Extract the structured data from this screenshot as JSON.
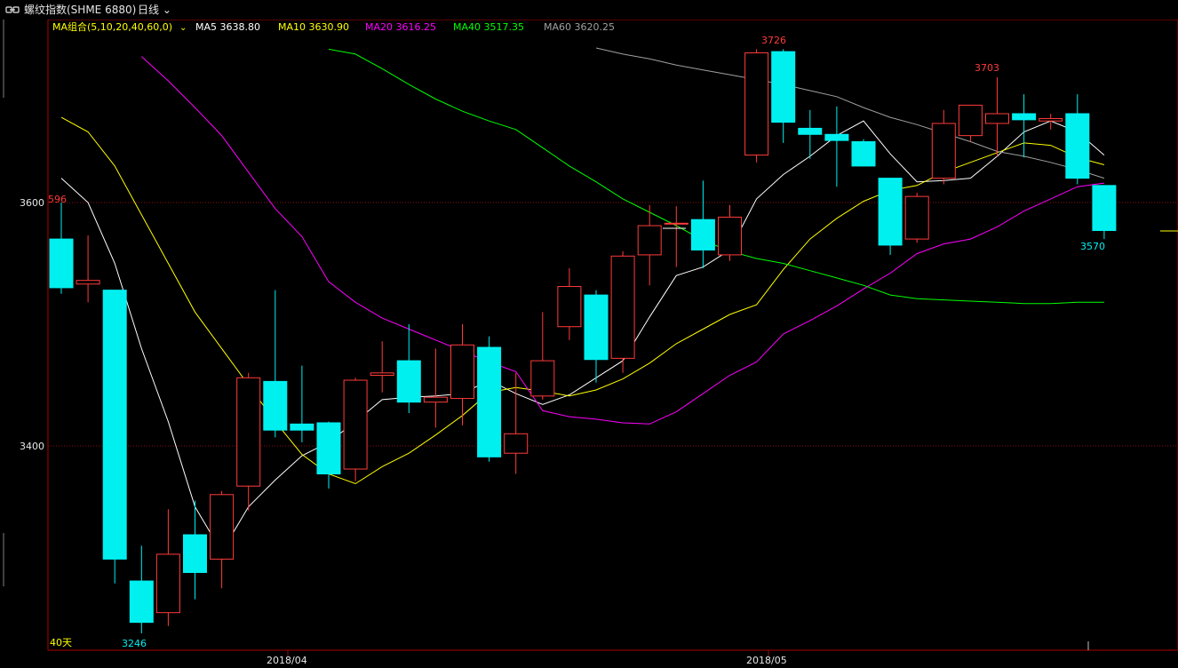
{
  "window": {
    "title": "螺纹指数(SHME 6880)",
    "period": "日线"
  },
  "ma_legend": {
    "group_label": "MA组合(5,10,20,40,60,0)",
    "items": [
      {
        "label": "MA5 3638.80",
        "color": "#ffffff"
      },
      {
        "label": "MA10 3630.90",
        "color": "#ffff00"
      },
      {
        "label": "MA20 3616.25",
        "color": "#ff00ff"
      },
      {
        "label": "MA40 3517.35",
        "color": "#00ff00"
      },
      {
        "label": "MA60 3620.25",
        "color": "#a0a0a0"
      }
    ]
  },
  "labels": {
    "left_price": "596",
    "range": "40天",
    "high_1": "3726",
    "high_2": "3703",
    "low": "3246",
    "last_low": "3570"
  },
  "colors": {
    "up": "#ff3b3b",
    "down": "#00f0f0",
    "grid": "#8a1010",
    "axis": "#b00000"
  },
  "chart_data": {
    "type": "candlestick",
    "y_ticks": [
      3600,
      3400
    ],
    "x_labels": [
      "2018/04",
      "2018/05"
    ],
    "candles": [
      {
        "open": 3570,
        "close": 3530,
        "high": 3600,
        "low": 3525
      },
      {
        "open": 3533,
        "close": 3536,
        "high": 3573,
        "low": 3518
      },
      {
        "open": 3528,
        "close": 3307,
        "high": 3528,
        "low": 3287
      },
      {
        "open": 3289,
        "close": 3255,
        "high": 3318,
        "low": 3246
      },
      {
        "open": 3263,
        "close": 3311,
        "high": 3348,
        "low": 3252
      },
      {
        "open": 3327,
        "close": 3296,
        "high": 3355,
        "low": 3274
      },
      {
        "open": 3307,
        "close": 3360,
        "high": 3363,
        "low": 3283
      },
      {
        "open": 3367,
        "close": 3456,
        "high": 3460,
        "low": 3347
      },
      {
        "open": 3453,
        "close": 3413,
        "high": 3528,
        "low": 3407
      },
      {
        "open": 3418,
        "close": 3413,
        "high": 3466,
        "low": 3403
      },
      {
        "open": 3419,
        "close": 3377,
        "high": 3420,
        "low": 3365
      },
      {
        "open": 3381,
        "close": 3454,
        "high": 3456,
        "low": 3371
      },
      {
        "open": 3458,
        "close": 3460,
        "high": 3486,
        "low": 3444
      },
      {
        "open": 3470,
        "close": 3436,
        "high": 3500,
        "low": 3427
      },
      {
        "open": 3436,
        "close": 3440,
        "high": 3480,
        "low": 3415
      },
      {
        "open": 3439,
        "close": 3483,
        "high": 3500,
        "low": 3417
      },
      {
        "open": 3481,
        "close": 3391,
        "high": 3490,
        "low": 3387
      },
      {
        "open": 3394,
        "close": 3410,
        "high": 3460,
        "low": 3377
      },
      {
        "open": 3441,
        "close": 3470,
        "high": 3510,
        "low": 3438
      },
      {
        "open": 3498,
        "close": 3531,
        "high": 3546,
        "low": 3487
      },
      {
        "open": 3524,
        "close": 3471,
        "high": 3528,
        "low": 3452
      },
      {
        "open": 3472,
        "close": 3556,
        "high": 3560,
        "low": 3460
      },
      {
        "open": 3557,
        "close": 3581,
        "high": 3598,
        "low": 3532
      },
      {
        "open": 3583,
        "close": 3583,
        "high": 3597,
        "low": 3547
      },
      {
        "open": 3586,
        "close": 3561,
        "high": 3618,
        "low": 3546
      },
      {
        "open": 3557,
        "close": 3588,
        "high": 3598,
        "low": 3552
      },
      {
        "open": 3639,
        "close": 3723,
        "high": 3726,
        "low": 3633
      },
      {
        "open": 3724,
        "close": 3666,
        "high": 3726,
        "low": 3649
      },
      {
        "open": 3661,
        "close": 3656,
        "high": 3676,
        "low": 3636
      },
      {
        "open": 3656,
        "close": 3651,
        "high": 3679,
        "low": 3613
      },
      {
        "open": 3650,
        "close": 3630,
        "high": 3652,
        "low": 3630
      },
      {
        "open": 3620,
        "close": 3565,
        "high": 3620,
        "low": 3557
      },
      {
        "open": 3570,
        "close": 3605,
        "high": 3608,
        "low": 3567
      },
      {
        "open": 3620,
        "close": 3665,
        "high": 3676,
        "low": 3615
      },
      {
        "open": 3655,
        "close": 3680,
        "high": 3680,
        "low": 3650
      },
      {
        "open": 3665,
        "close": 3673,
        "high": 3703,
        "low": 3638
      },
      {
        "open": 3673,
        "close": 3668,
        "high": 3689,
        "low": 3637
      },
      {
        "open": 3667,
        "close": 3669,
        "high": 3673,
        "low": 3660
      },
      {
        "open": 3673,
        "close": 3620,
        "high": 3689,
        "low": 3615
      },
      {
        "open": 3614,
        "close": 3577,
        "high": 3614,
        "low": 3570
      }
    ],
    "ma": {
      "ma5": [
        3620,
        3600,
        3550,
        3480,
        3420,
        3350,
        3313,
        3350,
        3372,
        3392,
        3403,
        3420,
        3438,
        3440,
        3441,
        3443,
        3454,
        3443,
        3434,
        3442,
        3456,
        3470,
        3506,
        3540,
        3547,
        3561,
        3603,
        3623,
        3638,
        3655,
        3667,
        3640,
        3617,
        3618,
        3620,
        3638,
        3658,
        3667,
        3658,
        3639
      ],
      "ma10": [
        3670,
        3658,
        3630,
        3590,
        3550,
        3510,
        3480,
        3450,
        3420,
        3393,
        3377,
        3369,
        3383,
        3394,
        3409,
        3425,
        3444,
        3448,
        3445,
        3441,
        3446,
        3455,
        3468,
        3484,
        3496,
        3508,
        3516,
        3545,
        3570,
        3587,
        3601,
        3610,
        3614,
        3625,
        3633,
        3641,
        3649,
        3647,
        3637,
        3631
      ],
      "ma20": [
        null,
        null,
        null,
        3720,
        3700,
        3678,
        3655,
        3625,
        3595,
        3572,
        3535,
        3518,
        3505,
        3496,
        3487,
        3478,
        3469,
        3461,
        3429,
        3424,
        3422,
        3419,
        3418,
        3428,
        3443,
        3458,
        3469,
        3492,
        3503,
        3515,
        3529,
        3542,
        3558,
        3566,
        3570,
        3580,
        3593,
        3603,
        3613,
        3616
      ],
      "ma40": [
        null,
        null,
        null,
        null,
        null,
        null,
        null,
        null,
        null,
        null,
        3726,
        3722,
        3710,
        3697,
        3685,
        3675,
        3667,
        3660,
        3645,
        3630,
        3617,
        3603,
        3592,
        3581,
        3569,
        3560,
        3554,
        3550,
        3544,
        3538,
        3532,
        3524,
        3521,
        3520,
        3519,
        3518,
        3517,
        3517,
        3518,
        3518
      ],
      "ma60": [
        null,
        null,
        null,
        null,
        null,
        null,
        null,
        null,
        null,
        null,
        null,
        null,
        null,
        null,
        null,
        null,
        null,
        null,
        null,
        null,
        3727,
        3722,
        3718,
        3713,
        3709,
        3705,
        3701,
        3697,
        3692,
        3687,
        3678,
        3670,
        3664,
        3657,
        3650,
        3642,
        3638,
        3633,
        3627,
        3620
      ]
    }
  }
}
